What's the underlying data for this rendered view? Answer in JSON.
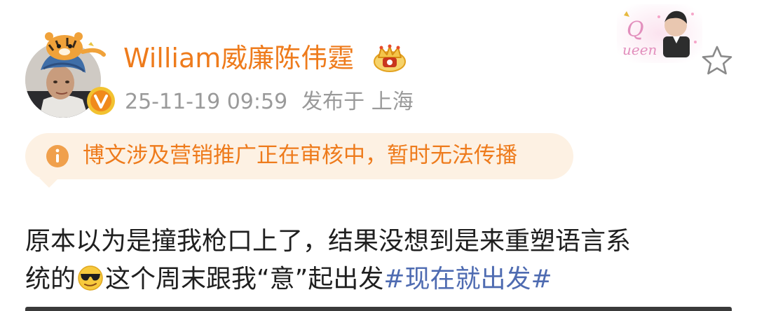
{
  "post": {
    "author": {
      "name": "William威廉陈伟霆",
      "verified": true,
      "verified_color": "#f08a1c",
      "vip_badge": "crown-icon"
    },
    "meta": {
      "datetime": "25-11-19 09:59",
      "location": "发布于 上海"
    },
    "fan_badge": {
      "letters": "Queen",
      "icon": "queen-fan-badge"
    },
    "notice": {
      "text": "博文涉及营销推广正在审核中，暂时无法传播",
      "icon": "info-icon",
      "color": "#ee7b1c",
      "background": "#fdf1e3"
    },
    "content": {
      "line1": "原本以为是撞我枪口上了，结果没想到是来重塑语言系",
      "line2_before_emoji": "统的",
      "emoji": "sunglasses-emoji",
      "line2_after_emoji": "这个周末跟我“意”起出发",
      "hashtag": "#现在就出发#",
      "hashtag_color": "#4e6bb1"
    },
    "colors": {
      "username": "#ee7b1c",
      "meta": "#9a9a9a",
      "body": "#1f1f1f"
    }
  }
}
